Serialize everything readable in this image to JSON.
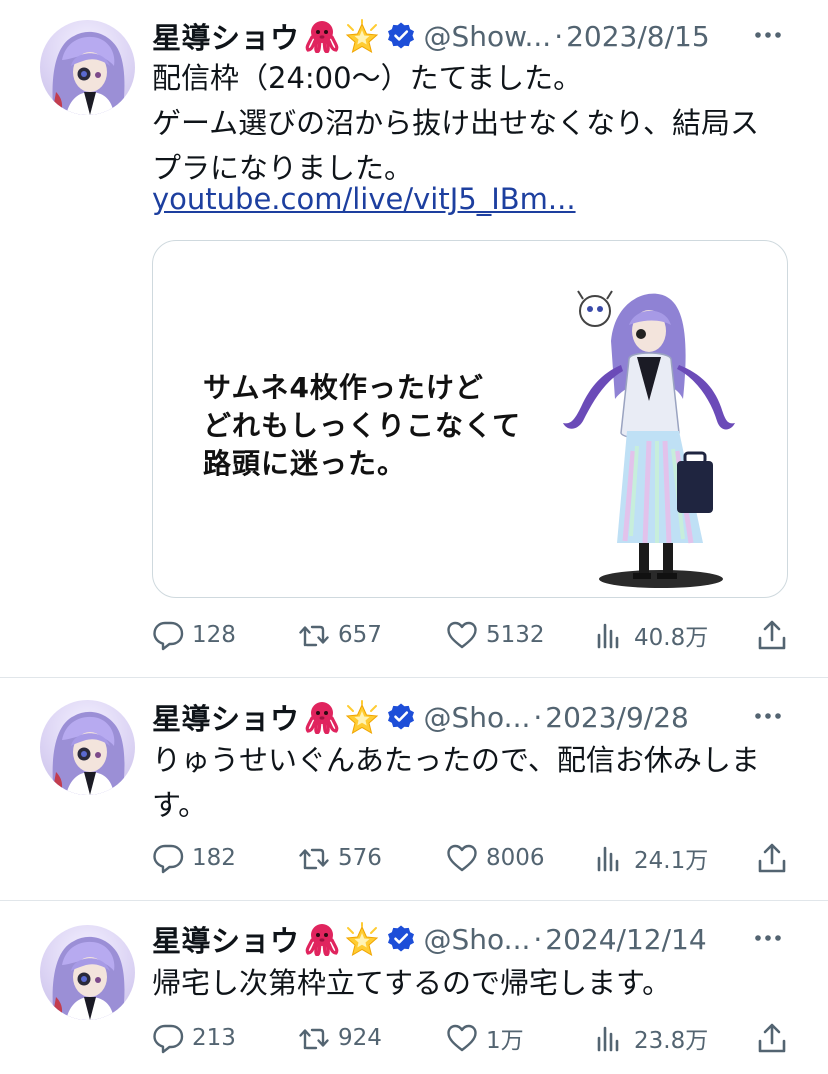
{
  "tweets": [
    {
      "name": "星導ショウ",
      "handle": "@Show...",
      "date": "2023/8/15",
      "text": "配信枠（24:00〜）たてました。\nゲーム選びの沼から抜け出せなくなり、結局ス\nプラになりました。",
      "link": "youtube.com/live/vitJ5_IBm...",
      "card_text": "サムネ4枚作ったけど\nどれもしっくりこなくて\n路頭に迷った。",
      "replies": "128",
      "retweets": "657",
      "likes": "5132",
      "views": "40.8万"
    },
    {
      "name": "星導ショウ",
      "handle": "@Sho...",
      "date": "2023/9/28",
      "text": "りゅうせいぐんあたったので、配信お休みしま\nす。",
      "replies": "182",
      "retweets": "576",
      "likes": "8006",
      "views": "24.1万"
    },
    {
      "name": "星導ショウ",
      "handle": "@Sho...",
      "date": "2024/12/14",
      "text": "帰宅し次第枠立てするので帰宅します。",
      "replies": "213",
      "retweets": "924",
      "likes": "1万",
      "views": "23.8万"
    }
  ],
  "icons": {
    "emoji_1": "octopus-icon",
    "emoji_2": "glowing-star-icon",
    "verified": "verified-badge-icon",
    "more": "more-options-icon",
    "reply": "reply-icon",
    "retweet": "retweet-icon",
    "like": "like-icon",
    "views": "views-icon",
    "share": "share-icon"
  },
  "colors": {
    "text": "#0f1419",
    "muted": "#536471",
    "link": "#1d3f9f",
    "verified": "#1d4ed8",
    "divider": "#e1e6ea",
    "octopus": "#e0245e",
    "star": "#ffcc33"
  }
}
